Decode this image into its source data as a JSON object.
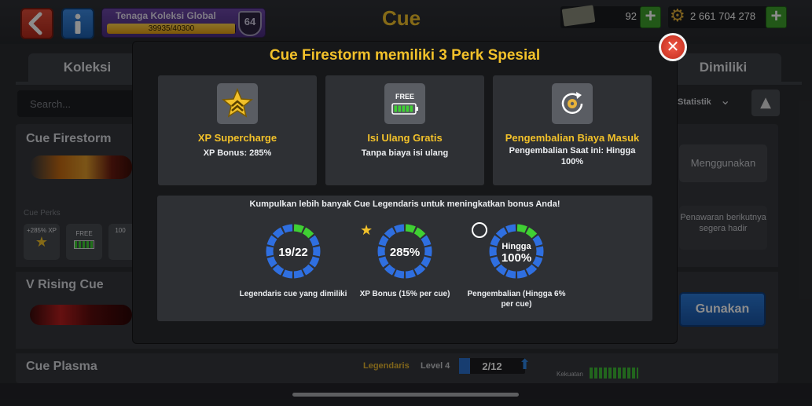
{
  "header": {
    "title": "Cue",
    "collection_title": "Tenaga Koleksi Global",
    "collection_progress": "39935/40300",
    "collection_fraction": 0.9909,
    "level": "64",
    "cash": "92",
    "coins": "2 661 704 278",
    "plus_symbol": "+"
  },
  "tabs": {
    "koleksi": "Koleksi",
    "dimiliki": "Dimiliki"
  },
  "search": {
    "placeholder": "Search..."
  },
  "sort": {
    "label": "Statistik"
  },
  "list": {
    "cue1": {
      "name": "Cue Firestorm",
      "perks_label": "Cue Perks",
      "perk1": "+285% XP",
      "perk2": "FREE",
      "perk3": "100",
      "use_label": "Menggunakan",
      "offer_label": "Penawaran berikutnya segera hadir"
    },
    "cue2": {
      "name": "V Rising Cue",
      "use_label": "Gunakan"
    },
    "cue3": {
      "name": "Cue Plasma",
      "rarity": "Legendaris",
      "level": "Level 4",
      "progress": "2/12",
      "strength_label": "Kekuatan"
    }
  },
  "modal": {
    "title": "Cue Firestorm memiliki 3 Perk Spesial",
    "perks": [
      {
        "name": "XP Supercharge",
        "desc": "XP Bonus: 285%",
        "icon": "star-chevron-icon"
      },
      {
        "name": "Isi Ulang Gratis",
        "desc": "Tanpa biaya isi ulang",
        "badge": "FREE",
        "icon": "battery-icon"
      },
      {
        "name": "Pengembalian Biaya Masuk",
        "desc": "Pengembalian Saat ini: Hingga 100%",
        "icon": "refund-gear-icon"
      }
    ],
    "bonus_header": "Kumpulkan lebih banyak Cue Legendaris untuk meningkatkan bonus Anda!",
    "rings": [
      {
        "value": "19/22",
        "label": "Legendaris cue yang dimiliki",
        "fraction": 0.86
      },
      {
        "value": "285%",
        "label": "XP Bonus (15% per cue)",
        "fraction": 0.86
      },
      {
        "value_top": "Hingga",
        "value": "100%",
        "label": "Pengembalian (Hingga 6% per cue)",
        "fraction": 0.86
      }
    ]
  },
  "colors": {
    "accent_gold": "#f2c12a",
    "ring_blue": "#2f6fe0",
    "ring_green": "#3fcf33",
    "button_blue": "#2b7ad8",
    "close_red": "#e0402e"
  }
}
